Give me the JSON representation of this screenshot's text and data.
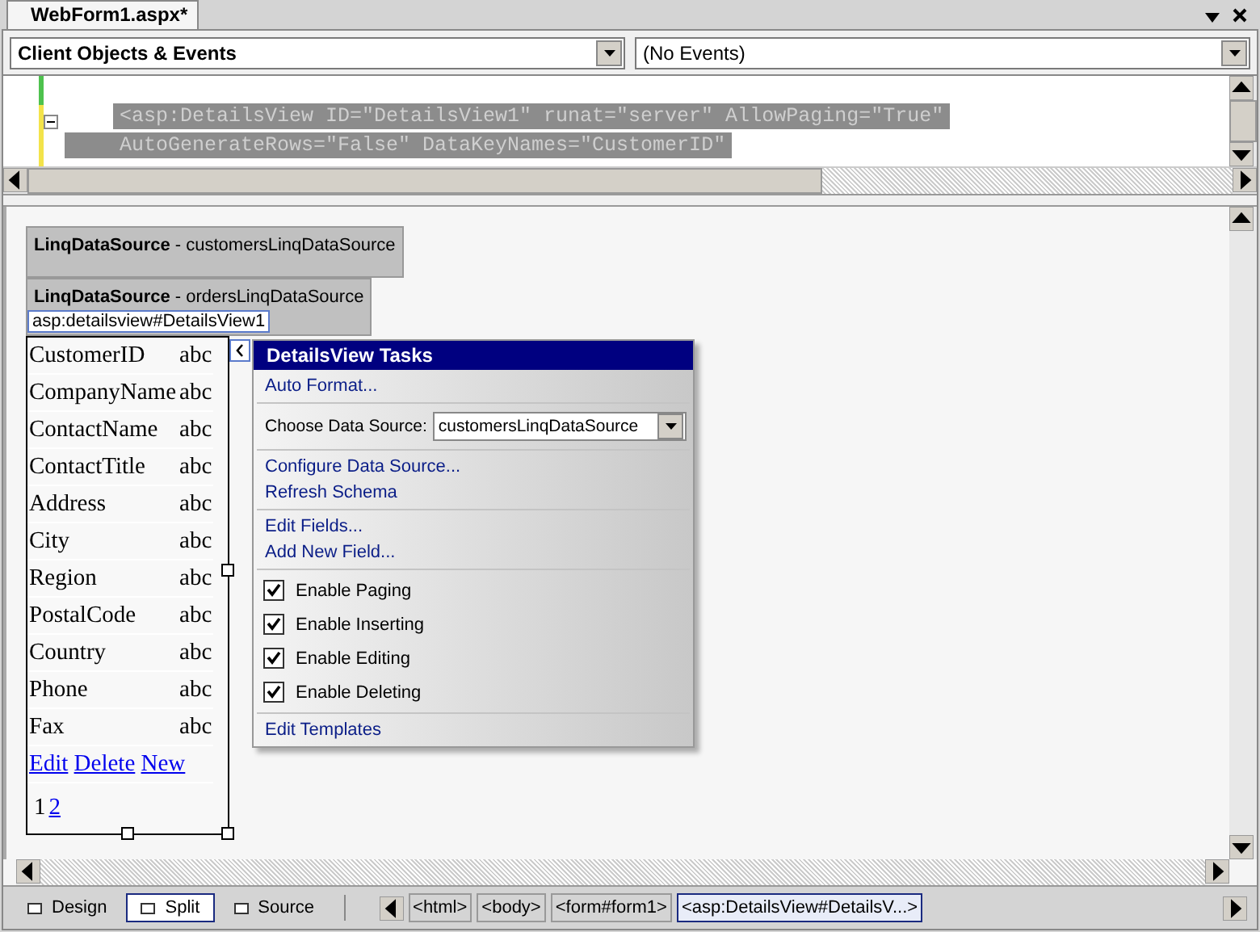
{
  "document_tab": {
    "title": "WebForm1.aspx*"
  },
  "object_dropdown": {
    "value": "Client Objects & Events"
  },
  "event_dropdown": {
    "value": "(No Events)"
  },
  "code_lines": [
    "<asp:DetailsView ID=\"DetailsView1\" runat=\"server\" AllowPaging=\"True\"",
    "    AutoGenerateRows=\"False\" DataKeyNames=\"CustomerID\""
  ],
  "data_sources": [
    {
      "label": "**LinqDataSource** - customersLinqDataSource"
    },
    {
      "label": "**LinqDataSource** - ordersLinqDataSource"
    }
  ],
  "details_view": {
    "tag": "asp:detailsview#DetailsView1",
    "fields": [
      {
        "name": "CustomerID",
        "value": "abc"
      },
      {
        "name": "CompanyName",
        "value": "abc"
      },
      {
        "name": "ContactName",
        "value": "abc"
      },
      {
        "name": "ContactTitle",
        "value": "abc"
      },
      {
        "name": "Address",
        "value": "abc"
      },
      {
        "name": "City",
        "value": "abc"
      },
      {
        "name": "Region",
        "value": "abc"
      },
      {
        "name": "PostalCode",
        "value": "abc"
      },
      {
        "name": "Country",
        "value": "abc"
      },
      {
        "name": "Phone",
        "value": "abc"
      },
      {
        "name": "Fax",
        "value": "abc"
      }
    ],
    "commands": [
      "Edit",
      "Delete",
      "New"
    ],
    "pager": [
      {
        "label": "1",
        "selected": true
      },
      {
        "label": "2",
        "selected": false
      }
    ]
  },
  "smart_tag": {
    "title": "DetailsView Tasks",
    "sections": [
      [
        {
          "kind": "link",
          "label": "Auto Format..."
        }
      ],
      [
        {
          "kind": "select",
          "label": "Choose Data Source:",
          "value": "customersLinqDataSource"
        }
      ],
      [
        {
          "kind": "link",
          "label": "Configure Data Source..."
        },
        {
          "kind": "link",
          "label": "Refresh Schema"
        }
      ],
      [
        {
          "kind": "link",
          "label": "Edit Fields..."
        },
        {
          "kind": "link",
          "label": "Add New Field..."
        }
      ],
      [
        {
          "kind": "checkbox",
          "label": "Enable Paging",
          "checked": true
        },
        {
          "kind": "checkbox",
          "label": "Enable Inserting",
          "checked": true
        },
        {
          "kind": "checkbox",
          "label": "Enable Editing",
          "checked": true
        },
        {
          "kind": "checkbox",
          "label": "Enable Deleting",
          "checked": true
        }
      ],
      [
        {
          "kind": "link",
          "label": "Edit Templates"
        }
      ]
    ]
  },
  "view_tabs": [
    {
      "label": "Design",
      "selected": false
    },
    {
      "label": "Split",
      "selected": true
    },
    {
      "label": "Source",
      "selected": false
    }
  ],
  "breadcrumbs": [
    {
      "label": "<html>",
      "selected": false
    },
    {
      "label": "<body>",
      "selected": false
    },
    {
      "label": "<form#form1>",
      "selected": false
    },
    {
      "label": "<asp:DetailsView#DetailsV...>",
      "selected": true
    }
  ]
}
